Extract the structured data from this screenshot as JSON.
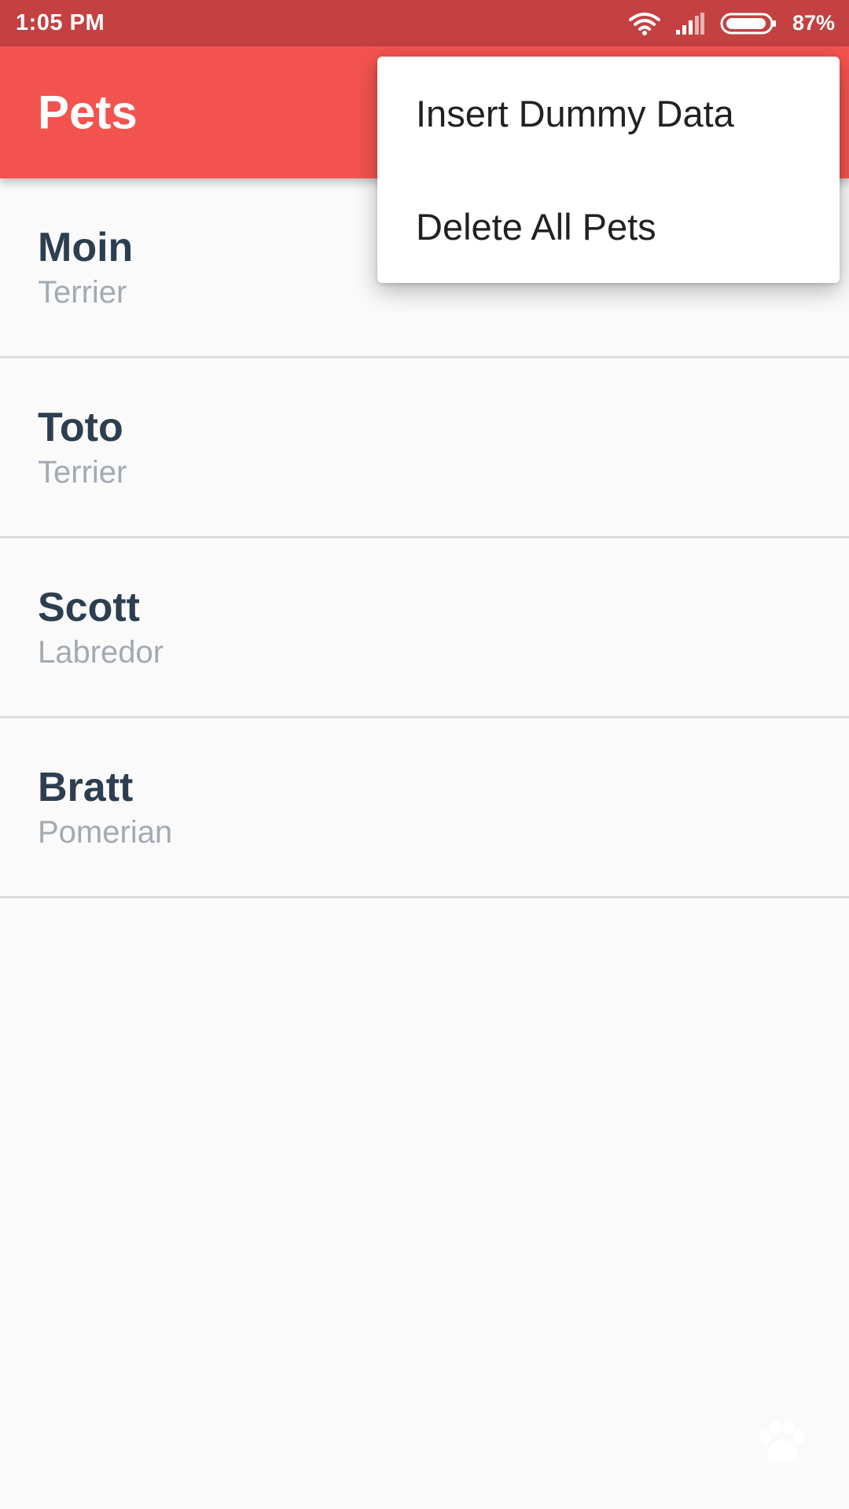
{
  "status_bar": {
    "time": "1:05 PM",
    "battery_percent": "87%",
    "icons": [
      "wifi-icon",
      "signal-icon",
      "battery-icon"
    ]
  },
  "app_bar": {
    "title": "Pets",
    "background_color": "#f3534e"
  },
  "menu": {
    "items": [
      {
        "label": "Insert Dummy Data"
      },
      {
        "label": "Delete All Pets"
      }
    ]
  },
  "pets": [
    {
      "name": "Moin",
      "breed": "Terrier"
    },
    {
      "name": "Toto",
      "breed": "Terrier"
    },
    {
      "name": "Scott",
      "breed": "Labredor"
    },
    {
      "name": "Bratt",
      "breed": "Pomerian"
    }
  ],
  "fab": {
    "icon": "paw-icon"
  },
  "colors": {
    "status_bar": "#c44142",
    "accent": "#f3534e",
    "pet_name": "#2c3e50",
    "pet_breed": "#a3aab1"
  }
}
